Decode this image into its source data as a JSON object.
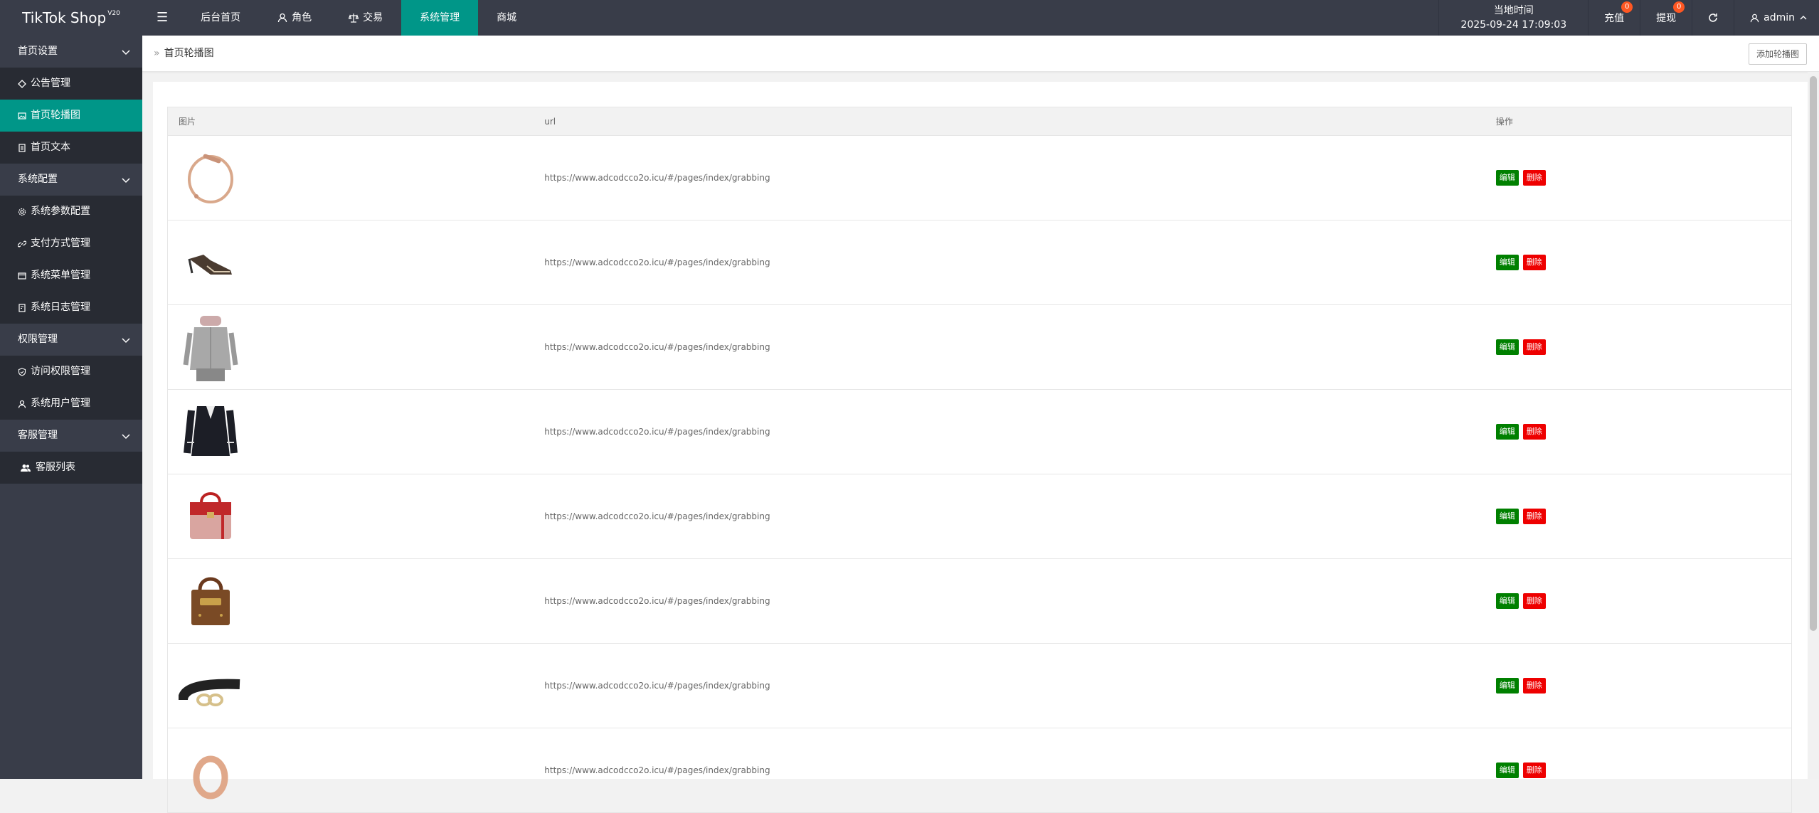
{
  "app": {
    "logo": "TikTok Shop",
    "version": "V20"
  },
  "topnav": {
    "items": [
      {
        "label": "后台首页"
      },
      {
        "label": "角色"
      },
      {
        "label": "交易"
      },
      {
        "label": "系统管理"
      },
      {
        "label": "商城"
      }
    ]
  },
  "header_right": {
    "time_label": "当地时间",
    "time_value": "2025-09-24 17:09:03",
    "recharge_label": "充值",
    "recharge_badge": "0",
    "withdraw_label": "提现",
    "withdraw_badge": "0",
    "user": "admin"
  },
  "sidebar": {
    "groups": [
      {
        "label": "首页设置",
        "items": [
          {
            "label": "公告管理"
          },
          {
            "label": "首页轮播图"
          },
          {
            "label": "首页文本"
          }
        ]
      },
      {
        "label": "系统配置",
        "items": [
          {
            "label": "系统参数配置"
          },
          {
            "label": "支付方式管理"
          },
          {
            "label": "系统菜单管理"
          },
          {
            "label": "系统日志管理"
          }
        ]
      },
      {
        "label": "权限管理",
        "items": [
          {
            "label": "访问权限管理"
          },
          {
            "label": "系统用户管理"
          }
        ]
      },
      {
        "label": "客服管理",
        "items": [
          {
            "label": "客服列表"
          }
        ]
      }
    ]
  },
  "breadcrumb": {
    "label": "首页轮播图"
  },
  "toolbar": {
    "add_label": "添加轮播图"
  },
  "table": {
    "headers": [
      "图片",
      "url",
      "操作"
    ],
    "edit_label": "编辑",
    "delete_label": "删除",
    "rows": [
      {
        "image": "bracelet",
        "url": "https://www.adcodcco2o.icu/#/pages/index/grabbing"
      },
      {
        "image": "heels",
        "url": "https://www.adcodcco2o.icu/#/pages/index/grabbing"
      },
      {
        "image": "cardigan",
        "url": "https://www.adcodcco2o.icu/#/pages/index/grabbing"
      },
      {
        "image": "blazer",
        "url": "https://www.adcodcco2o.icu/#/pages/index/grabbing"
      },
      {
        "image": "red-handbag",
        "url": "https://www.adcodcco2o.icu/#/pages/index/grabbing"
      },
      {
        "image": "brown-handbag",
        "url": "https://www.adcodcco2o.icu/#/pages/index/grabbing"
      },
      {
        "image": "belt",
        "url": "https://www.adcodcco2o.icu/#/pages/index/grabbing"
      },
      {
        "image": "ring",
        "url": "https://www.adcodcco2o.icu/#/pages/index/grabbing"
      }
    ]
  },
  "colors": {
    "header_bg": "#393d49",
    "accent": "#009688",
    "edit": "#008000",
    "delete": "#ee0000",
    "badge": "#ff5722"
  }
}
